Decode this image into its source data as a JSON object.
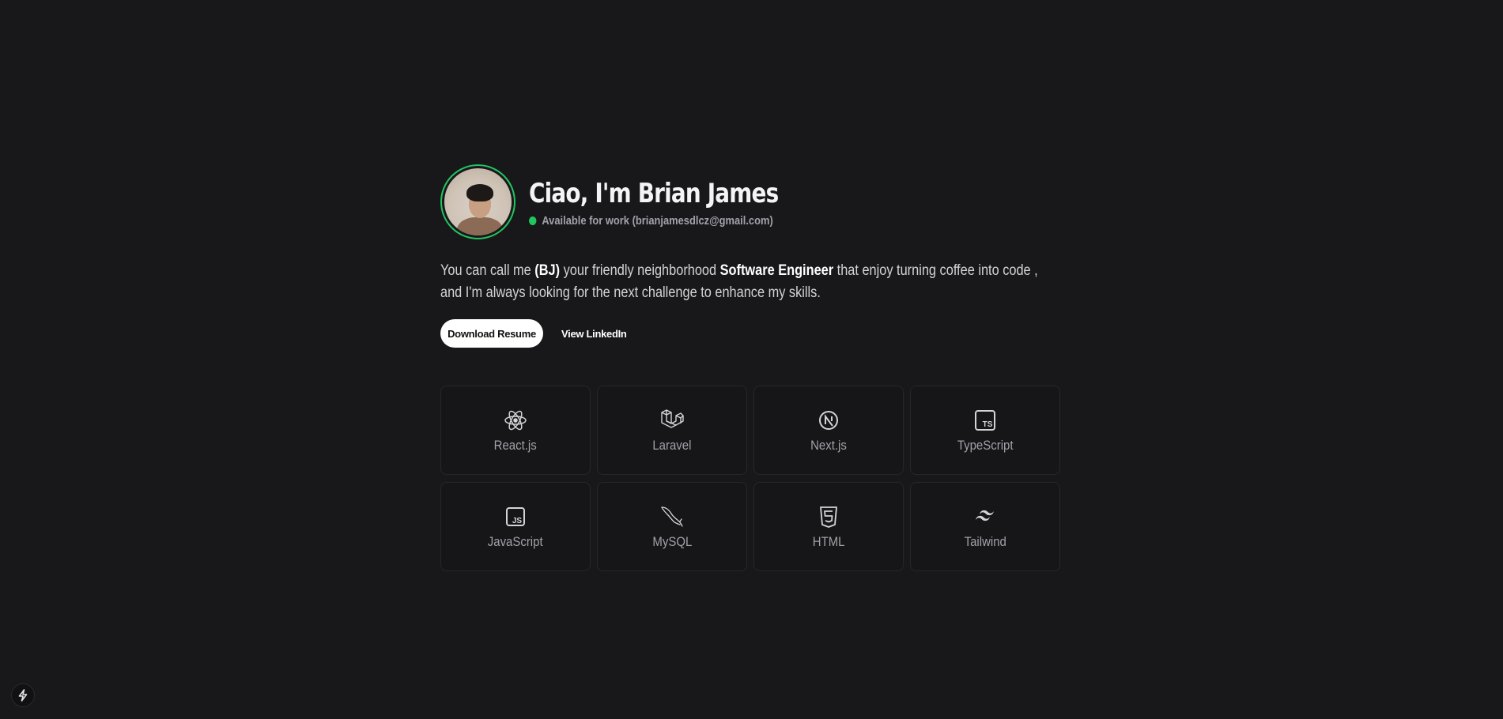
{
  "profile": {
    "greeting": "Ciao, I'm Brian James",
    "status": "Available for work (brianjamesdlcz@gmail.com)",
    "status_color": "#22c55e"
  },
  "intro": {
    "part1": "You can call me ",
    "nickname": "(BJ)",
    "part2": " your friendly neighborhood ",
    "role": "Software Engineer",
    "part3": " that enjoy turning coffee into code , and I'm always looking for the next challenge to enhance my skills."
  },
  "actions": {
    "download_resume": "Download Resume",
    "view_linkedin": "View LinkedIn"
  },
  "skills": [
    {
      "label": "React.js",
      "icon": "react-icon"
    },
    {
      "label": "Laravel",
      "icon": "laravel-icon"
    },
    {
      "label": "Next.js",
      "icon": "nextjs-icon"
    },
    {
      "label": "TypeScript",
      "icon": "typescript-icon"
    },
    {
      "label": "JavaScript",
      "icon": "javascript-icon"
    },
    {
      "label": "MySQL",
      "icon": "mysql-icon"
    },
    {
      "label": "HTML",
      "icon": "html5-icon"
    },
    {
      "label": "Tailwind",
      "icon": "tailwind-icon"
    }
  ],
  "corner_badge": {
    "icon": "lightning-icon"
  },
  "colors": {
    "background": "#18181b",
    "accent": "#22c55e",
    "card_border": "#27272a"
  }
}
